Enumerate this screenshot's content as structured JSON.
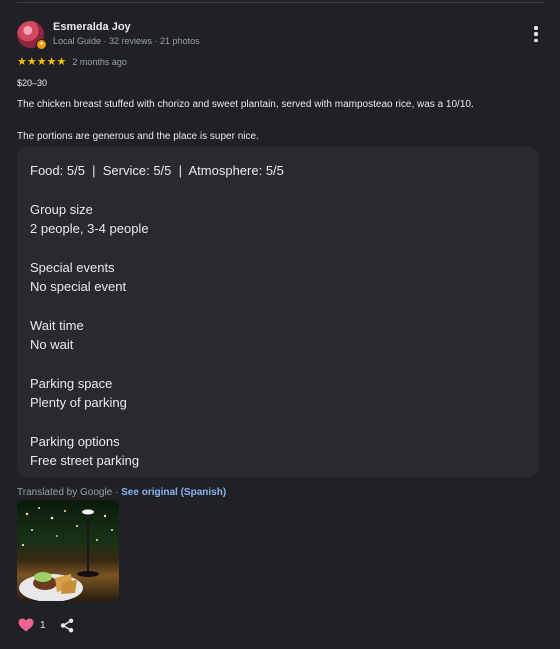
{
  "reviewer": {
    "name": "Esmeralda Joy",
    "meta": "Local Guide · 32 reviews · 21 photos",
    "badge_glyph": "✦"
  },
  "rating": {
    "stars": "★★★★★",
    "date": "2 months ago"
  },
  "price": "$20–30",
  "review": {
    "line1": "The chicken breast stuffed with chorizo and sweet plantain, served with mamposteao rice, was a 10/10.",
    "line2": "The portions are generous and the place is super nice."
  },
  "details": {
    "scores": "Food: 5/5  |  Service: 5/5  |  Atmosphere: 5/5",
    "group_size_label": "Group size",
    "group_size_value": "2 people, 3-4 people",
    "special_events_label": "Special events",
    "special_events_value": "No special event",
    "wait_time_label": "Wait time",
    "wait_time_value": "No wait",
    "parking_space_label": "Parking space",
    "parking_space_value": "Plenty of parking",
    "parking_options_label": "Parking options",
    "parking_options_value": "Free street parking"
  },
  "translation": {
    "prefix": "Translated by Google · ",
    "link": "See original (Spanish)"
  },
  "actions": {
    "like_count": "1"
  },
  "colors": {
    "background": "#202124",
    "card": "#292a2d",
    "star": "#fbbc04",
    "link": "#8ab4f8",
    "heart": "#f06292"
  },
  "icons": [
    "more-vert-icon",
    "heart-icon",
    "share-icon"
  ]
}
